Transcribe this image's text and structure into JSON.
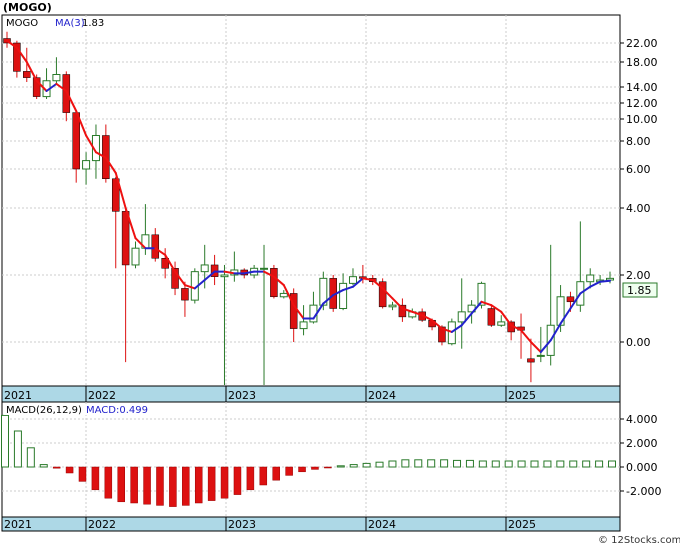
{
  "chart_data": [
    {
      "type": "candlestick",
      "title": "(MOGO)",
      "ticker": "MOGO",
      "ma_label": "MA(3)",
      "ma_value": "1.83",
      "last_price_label": "1.85",
      "x_tick_labels": [
        "2021",
        "2022",
        "2023",
        "2024",
        "2025"
      ],
      "y_tick_labels": [
        "22.00",
        "18.00",
        "14.00",
        "12.00",
        "10.00",
        "8.00",
        "6.00",
        "4.00",
        "2.00",
        "0.00"
      ],
      "y_scale": "log",
      "grid": true,
      "colors": {
        "up": "#2a7a2a",
        "down": "#dd1111",
        "ma_down": "#ee1111",
        "ma_up": "#2222cc",
        "axis_band": "#add8e6"
      },
      "candles": [
        {
          "o": 23.0,
          "h": 24.5,
          "l": 21.0,
          "c": 22.0
        },
        {
          "o": 22.0,
          "h": 22.5,
          "l": 15.5,
          "c": 16.5
        },
        {
          "o": 16.5,
          "h": 21.0,
          "l": 14.8,
          "c": 15.5
        },
        {
          "o": 15.5,
          "h": 16.0,
          "l": 12.5,
          "c": 12.8
        },
        {
          "o": 12.8,
          "h": 17.0,
          "l": 12.5,
          "c": 15.0
        },
        {
          "o": 15.0,
          "h": 19.0,
          "l": 14.5,
          "c": 16.0
        },
        {
          "o": 16.0,
          "h": 16.5,
          "l": 9.8,
          "c": 10.8
        },
        {
          "o": 10.8,
          "h": 11.0,
          "l": 5.3,
          "c": 6.0
        },
        {
          "o": 6.0,
          "h": 7.2,
          "l": 5.2,
          "c": 6.6
        },
        {
          "o": 6.6,
          "h": 9.5,
          "l": 5.5,
          "c": 8.5
        },
        {
          "o": 8.5,
          "h": 9.5,
          "l": 5.3,
          "c": 5.5
        },
        {
          "o": 5.5,
          "h": 5.6,
          "l": 2.2,
          "c": 3.9
        },
        {
          "o": 3.9,
          "h": 4.0,
          "l": -0.6,
          "c": 2.3
        },
        {
          "o": 2.3,
          "h": 3.0,
          "l": 2.2,
          "c": 2.8
        },
        {
          "o": 2.8,
          "h": 4.2,
          "l": 2.6,
          "c": 3.2
        },
        {
          "o": 3.2,
          "h": 3.4,
          "l": 2.4,
          "c": 2.5
        },
        {
          "o": 2.5,
          "h": 2.8,
          "l": 1.9,
          "c": 2.2
        },
        {
          "o": 2.2,
          "h": 2.4,
          "l": 1.4,
          "c": 1.6
        },
        {
          "o": 1.6,
          "h": 1.8,
          "l": 0.75,
          "c": 1.25
        },
        {
          "o": 1.25,
          "h": 2.2,
          "l": 1.15,
          "c": 2.1
        },
        {
          "o": 2.1,
          "h": 2.9,
          "l": 1.6,
          "c": 2.3
        },
        {
          "o": 2.3,
          "h": 2.6,
          "l": 1.7,
          "c": 1.95
        },
        {
          "o": 1.95,
          "h": 2.3,
          "l": -1.6,
          "c": 2.0
        },
        {
          "o": 2.0,
          "h": 2.7,
          "l": 1.8,
          "c": 2.15
        },
        {
          "o": 2.15,
          "h": 2.2,
          "l": 1.9,
          "c": 2.0
        },
        {
          "o": 2.0,
          "h": 2.3,
          "l": 1.9,
          "c": 2.2
        },
        {
          "o": 2.2,
          "h": 2.9,
          "l": -1.6,
          "c": 2.2
        },
        {
          "o": 2.2,
          "h": 2.3,
          "l": 1.3,
          "c": 1.35
        },
        {
          "o": 1.35,
          "h": 1.55,
          "l": 1.3,
          "c": 1.45
        },
        {
          "o": 1.45,
          "h": 1.6,
          "l": 0.0,
          "c": 0.4
        },
        {
          "o": 0.4,
          "h": 1.1,
          "l": 0.2,
          "c": 0.6
        },
        {
          "o": 0.6,
          "h": 1.5,
          "l": 0.55,
          "c": 1.1
        },
        {
          "o": 1.1,
          "h": 2.1,
          "l": 0.95,
          "c": 1.9
        },
        {
          "o": 1.9,
          "h": 2.0,
          "l": 0.9,
          "c": 1.0
        },
        {
          "o": 1.0,
          "h": 2.05,
          "l": 0.95,
          "c": 1.75
        },
        {
          "o": 1.75,
          "h": 2.2,
          "l": 1.7,
          "c": 1.95
        },
        {
          "o": 1.95,
          "h": 2.3,
          "l": 1.75,
          "c": 1.9
        },
        {
          "o": 1.9,
          "h": 2.0,
          "l": 1.7,
          "c": 1.8
        },
        {
          "o": 1.8,
          "h": 1.9,
          "l": 1.0,
          "c": 1.05
        },
        {
          "o": 1.05,
          "h": 1.2,
          "l": 0.95,
          "c": 1.1
        },
        {
          "o": 1.1,
          "h": 1.3,
          "l": 0.6,
          "c": 0.75
        },
        {
          "o": 0.75,
          "h": 1.0,
          "l": 0.7,
          "c": 0.9
        },
        {
          "o": 0.9,
          "h": 1.0,
          "l": 0.6,
          "c": 0.65
        },
        {
          "o": 0.65,
          "h": 0.7,
          "l": 0.35,
          "c": 0.45
        },
        {
          "o": 0.45,
          "h": 0.5,
          "l": -0.1,
          "c": 0.0
        },
        {
          "o": -0.05,
          "h": 0.7,
          "l": -0.1,
          "c": 0.6
        },
        {
          "o": 0.6,
          "h": 1.9,
          "l": -0.2,
          "c": 0.9
        },
        {
          "o": 0.9,
          "h": 1.25,
          "l": 0.55,
          "c": 1.1
        },
        {
          "o": 1.1,
          "h": 1.8,
          "l": 1.0,
          "c": 1.75
        },
        {
          "o": 1.0,
          "h": 1.1,
          "l": 0.45,
          "c": 0.5
        },
        {
          "o": 0.5,
          "h": 0.8,
          "l": 0.45,
          "c": 0.6
        },
        {
          "o": 0.6,
          "h": 0.65,
          "l": 0.05,
          "c": 0.3
        },
        {
          "o": 0.45,
          "h": 0.85,
          "l": -0.5,
          "c": 0.35
        },
        {
          "o": -0.5,
          "h": 0.1,
          "l": -1.2,
          "c": -0.6
        },
        {
          "o": -0.4,
          "h": 0.45,
          "l": -0.6,
          "c": -0.4
        },
        {
          "o": -0.4,
          "h": 2.9,
          "l": -0.7,
          "c": 0.5
        },
        {
          "o": 0.5,
          "h": 1.7,
          "l": 0.3,
          "c": 1.35
        },
        {
          "o": 1.35,
          "h": 1.5,
          "l": 0.9,
          "c": 1.2
        },
        {
          "o": 1.1,
          "h": 3.6,
          "l": 0.9,
          "c": 1.8
        },
        {
          "o": 1.8,
          "h": 2.2,
          "l": 1.6,
          "c": 2.0
        },
        {
          "o": 1.8,
          "h": 2.0,
          "l": 1.7,
          "c": 1.85
        },
        {
          "o": 1.85,
          "h": 2.1,
          "l": 1.75,
          "c": 1.9
        }
      ],
      "ma_values": [
        22.5,
        21.0,
        18.0,
        15.0,
        13.5,
        14.5,
        13.5,
        11.0,
        8.5,
        7.2,
        6.8,
        5.8,
        4.0,
        3.1,
        2.8,
        2.8,
        2.6,
        2.1,
        1.7,
        1.6,
        1.85,
        2.1,
        2.1,
        2.05,
        2.05,
        2.1,
        2.1,
        1.95,
        1.7,
        1.1,
        0.7,
        0.7,
        1.15,
        1.4,
        1.55,
        1.65,
        1.9,
        1.85,
        1.6,
        1.3,
        1.0,
        0.9,
        0.8,
        0.65,
        0.4,
        0.3,
        0.5,
        0.85,
        1.2,
        1.1,
        0.9,
        0.5,
        0.35,
        0.0,
        -0.3,
        0.05,
        0.55,
        1.0,
        1.45,
        1.65,
        1.8,
        1.83
      ],
      "macd_panel": {
        "label": "MACD(26,12,9)",
        "macd_label": "MACD:0.499",
        "y_tick_labels": [
          "4.000",
          "2.000",
          "0.000",
          "-2.000"
        ],
        "histogram": [
          4.3,
          3.0,
          1.6,
          0.2,
          -0.1,
          -0.5,
          -1.2,
          -1.9,
          -2.6,
          -2.9,
          -3.0,
          -3.1,
          -3.2,
          -3.3,
          -3.2,
          -3.0,
          -2.8,
          -2.6,
          -2.3,
          -1.9,
          -1.5,
          -1.1,
          -0.7,
          -0.4,
          -0.2,
          -0.05,
          0.1,
          0.2,
          0.3,
          0.4,
          0.5,
          0.6,
          0.6,
          0.6,
          0.6,
          0.55,
          0.55,
          0.5,
          0.5,
          0.5,
          0.5,
          0.5,
          0.5,
          0.5,
          0.5,
          0.5,
          0.5,
          0.5
        ]
      }
    }
  ]
}
